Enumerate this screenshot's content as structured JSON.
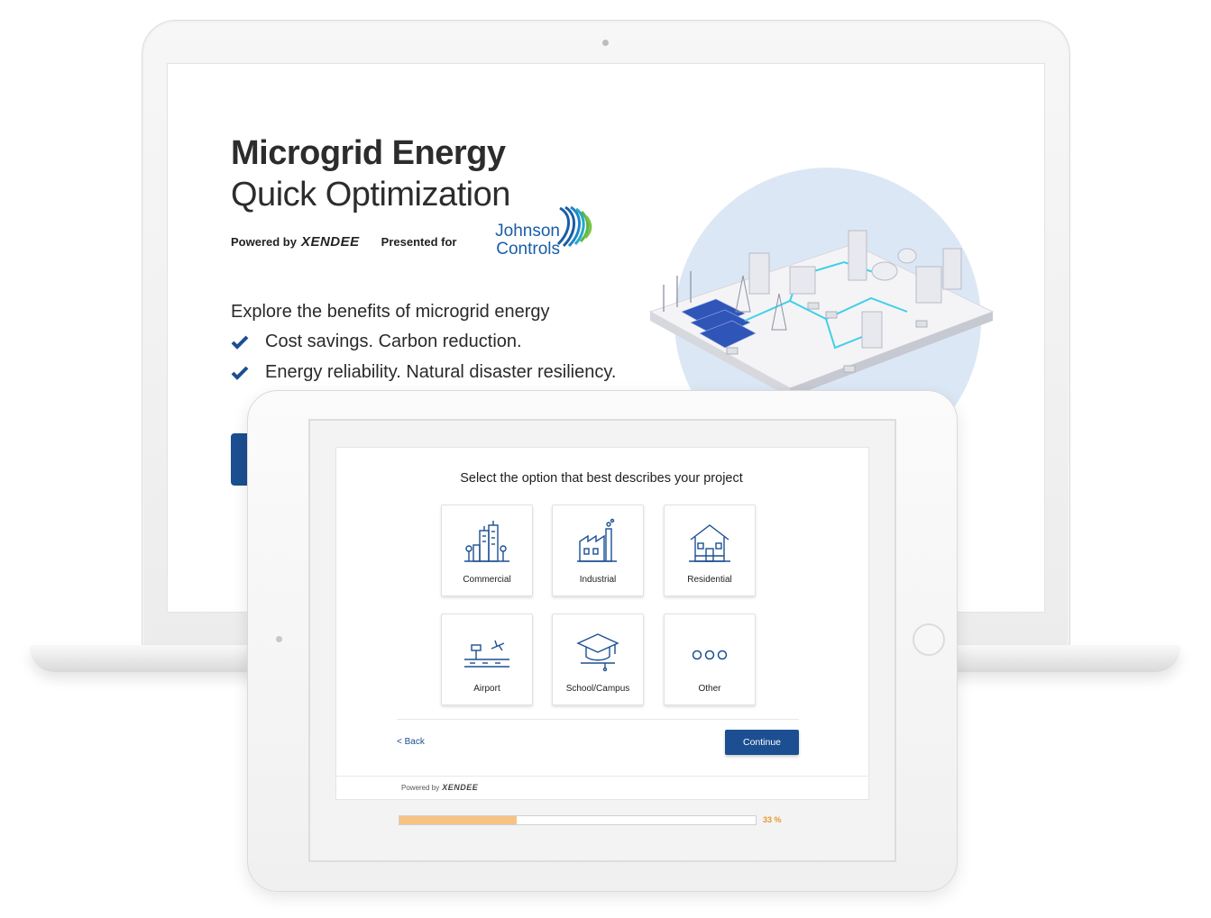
{
  "laptop": {
    "title_line1": "Microgrid Energy",
    "title_line2": "Quick Optimization",
    "powered_by": "Powered by",
    "brand": "XENDEE",
    "presented_for": "Presented for",
    "client_logo_line1": "Johnson",
    "client_logo_line2": "Controls",
    "intro": "Explore the benefits of microgrid energy",
    "benefits": [
      "Cost savings. Carbon reduction.",
      "Energy reliability. Natural disaster resiliency."
    ]
  },
  "tablet": {
    "question": "Select the option that best describes your project",
    "options": [
      {
        "label": "Commercial",
        "icon": "city-buildings-icon"
      },
      {
        "label": "Industrial",
        "icon": "factory-icon"
      },
      {
        "label": "Residential",
        "icon": "house-icon"
      },
      {
        "label": "Airport",
        "icon": "airport-icon"
      },
      {
        "label": "School/Campus",
        "icon": "graduation-cap-icon"
      },
      {
        "label": "Other",
        "icon": "more-dots-icon"
      }
    ],
    "back_label": "< Back",
    "continue_label": "Continue",
    "footer_powered": "Powered by",
    "footer_brand": "XENDEE",
    "progress_text": "33 %",
    "progress_value": 0.33
  },
  "colors": {
    "primary": "#1b4f91",
    "progress_fill": "#f7c384",
    "progress_text": "#e89a2f",
    "illustration_bg": "#dce7f5"
  }
}
